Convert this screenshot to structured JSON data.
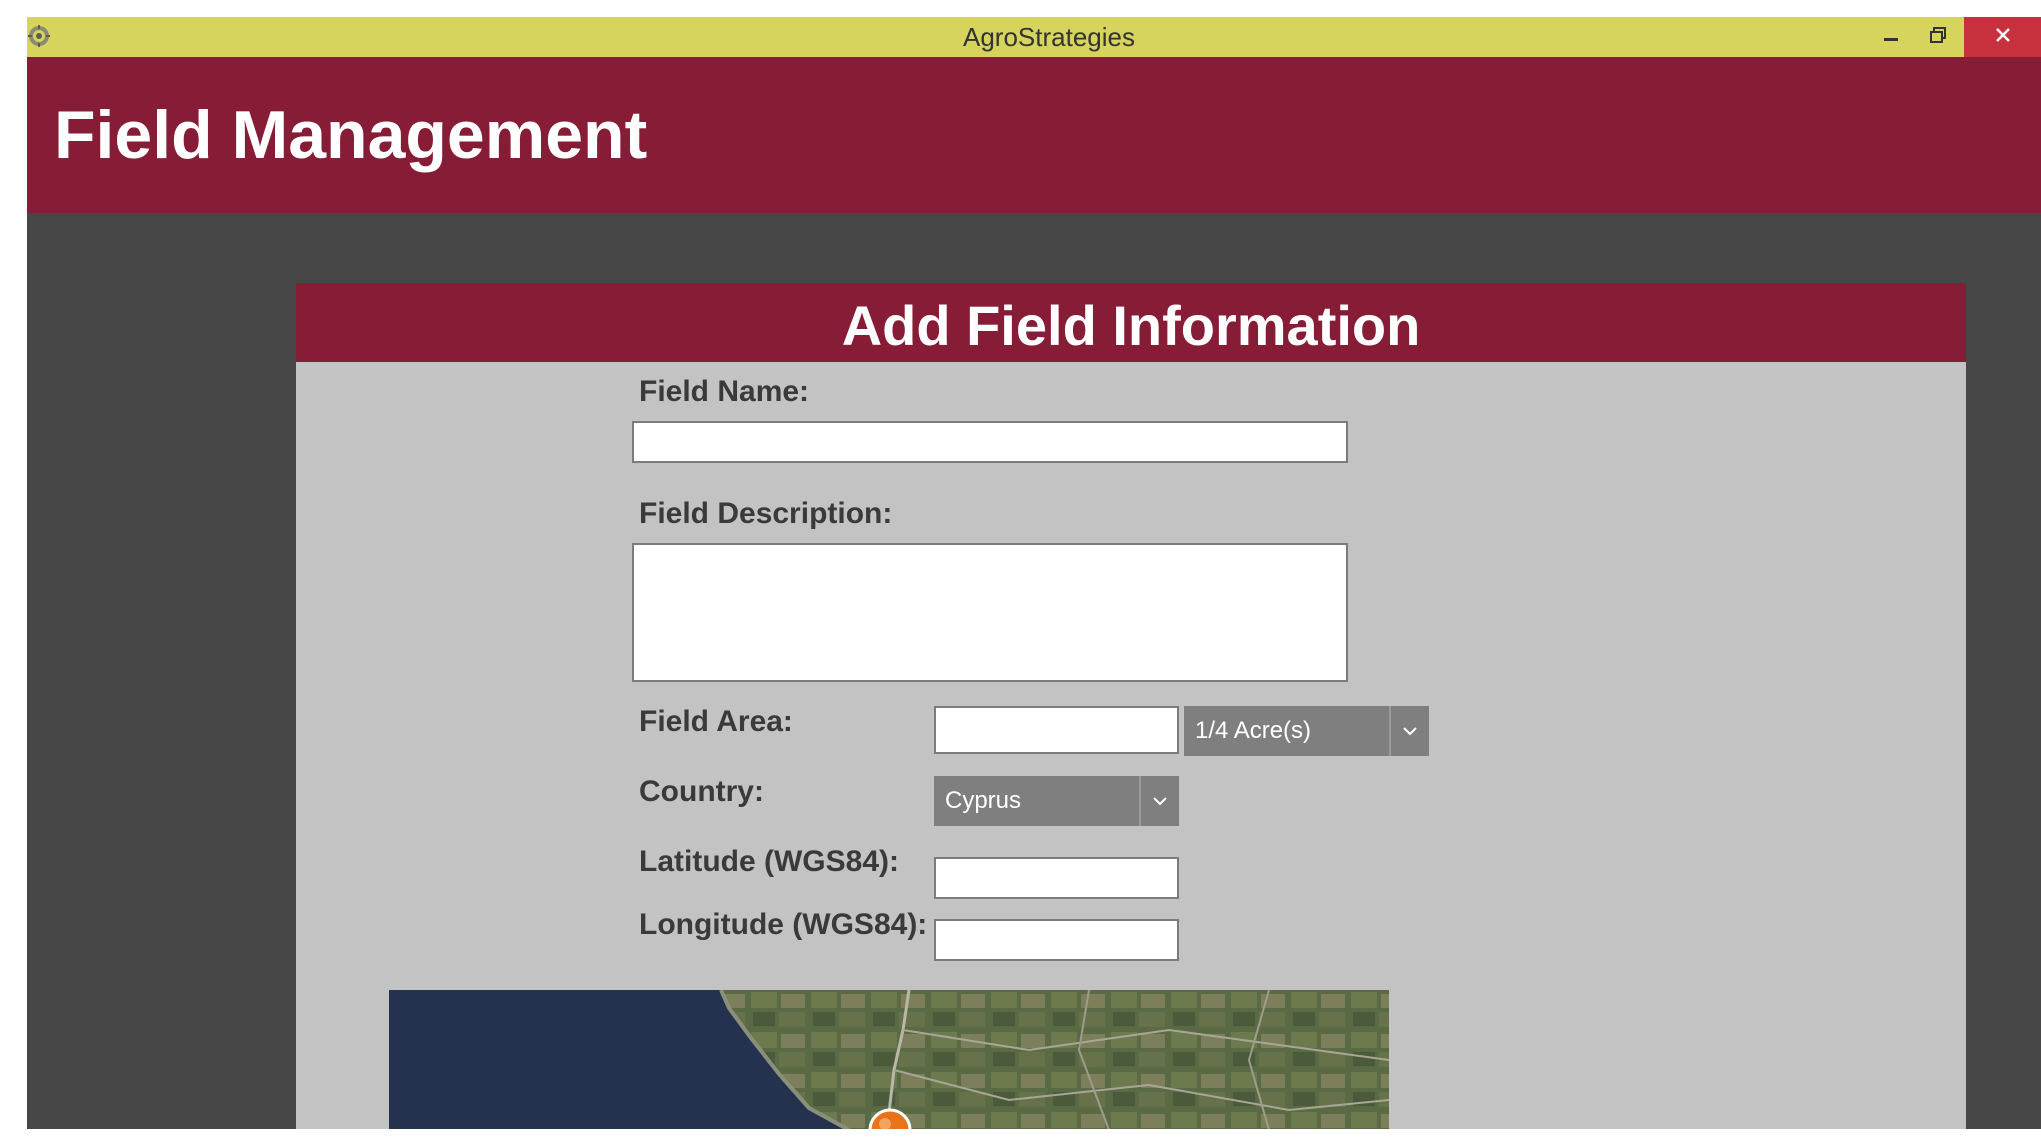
{
  "window": {
    "title": "AgroStrategies",
    "icon": "app-logo-icon",
    "controls": [
      "minimize-icon",
      "restore-icon",
      "close-icon"
    ],
    "titlebar_color": "#d7d45e",
    "close_color": "#c7303d"
  },
  "header": {
    "title": "Field Management",
    "color": "#861c35"
  },
  "form": {
    "title": "Add Field Information",
    "field_name": {
      "label": "Field Name:",
      "value": ""
    },
    "field_description": {
      "label": "Field Description:",
      "value": ""
    },
    "field_area": {
      "label": "Field Area:",
      "value": "",
      "unit_selected": "1/4 Acre(s)"
    },
    "country": {
      "label": "Country:",
      "selected": "Cyprus"
    },
    "latitude": {
      "label": "Latitude (WGS84):",
      "value": ""
    },
    "longitude": {
      "label": "Longitude (WGS84):",
      "value": ""
    }
  },
  "map": {
    "view": "satellite",
    "marker_icon": "location-pin-icon",
    "marker_color": "#e8731a"
  }
}
